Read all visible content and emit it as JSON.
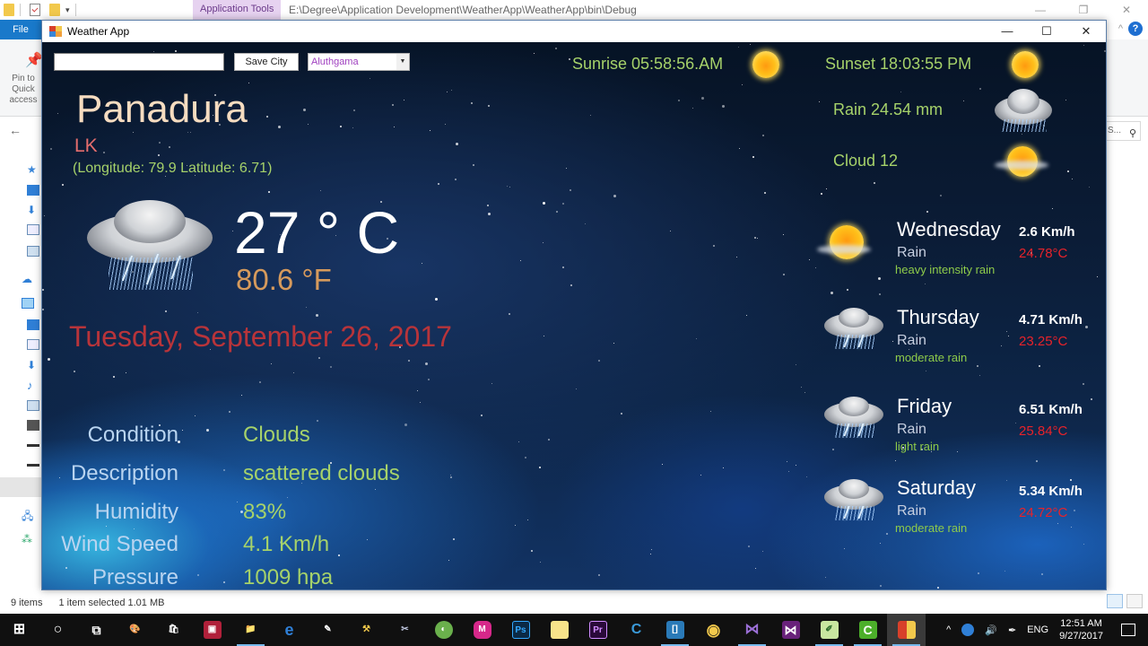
{
  "explorer": {
    "contextual_tab": "Application Tools",
    "path": "E:\\Degree\\Application Development\\WeatherApp\\WeatherApp\\bin\\Debug",
    "file_tab": "File",
    "pin_label": "Pin to Quick access",
    "search_placeholder": "S...",
    "status": {
      "items": "9 items",
      "selected": "1 item selected  1.01 MB"
    },
    "window_controls": {
      "minimize": "—",
      "restore": "❐",
      "close": "✕"
    }
  },
  "app": {
    "title": "Weather App",
    "window_controls": {
      "minimize": "—",
      "maximize": "☐",
      "close": "✕"
    },
    "controls": {
      "city_input_value": "",
      "save_button": "Save City",
      "city_select_value": "Aluthgama",
      "select_arrow": "▼"
    },
    "location": {
      "city": "Panadura",
      "country": "LK",
      "coordinates": "(Longitude: 79.9 Latitude: 6.71)"
    },
    "current": {
      "icon": "thunderstorm-icon",
      "temp_c": "27 ° C",
      "temp_f": "80.6 °F",
      "date": "Tuesday, September 26, 2017"
    },
    "sun": {
      "sunrise": "Sunrise  05:58:56.AM",
      "sunset": "Sunset 18:03:55 PM"
    },
    "extra": {
      "rain": "Rain   24.54 mm",
      "cloud": "Cloud 12"
    },
    "details": [
      {
        "label": "Condition",
        "value": "Clouds"
      },
      {
        "label": "Description",
        "value": "scattered clouds"
      },
      {
        "label": "Humidity",
        "value": "83%"
      },
      {
        "label": "Wind Speed",
        "value": "4.1 Km/h"
      },
      {
        "label": "Pressure",
        "value": "1009 hpa"
      }
    ],
    "forecast": [
      {
        "day": "Wednesday",
        "main": "Rain",
        "description": "heavy intensity rain",
        "wind": "2.6 Km/h",
        "temp": "24.78°C",
        "icon": "partly-sunny-icon"
      },
      {
        "day": "Thursday",
        "main": "Rain",
        "description": "moderate rain",
        "wind": "4.71 Km/h",
        "temp": "23.25°C",
        "icon": "thunderstorm-icon"
      },
      {
        "day": "Friday",
        "main": "Rain",
        "description": "light rain",
        "wind": "6.51 Km/h",
        "temp": "25.84°C",
        "icon": "thunderstorm-icon"
      },
      {
        "day": "Saturday",
        "main": "Rain",
        "description": "moderate rain",
        "wind": "5.34 Km/h",
        "temp": "24.72°C",
        "icon": "thunderstorm-icon"
      }
    ],
    "colors": {
      "accent_green": "#a6d26a",
      "date_red": "#b8343a",
      "forecast_temp_red": "#e8222a",
      "city_color": "#f6dcc0"
    }
  },
  "taskbar": {
    "apps": [
      {
        "name": "start",
        "glyph": "⊞"
      },
      {
        "name": "cortana",
        "glyph": "○"
      },
      {
        "name": "task-view",
        "glyph": "⧉"
      },
      {
        "name": "paint",
        "glyph": "🎨"
      },
      {
        "name": "store",
        "glyph": "🛍"
      },
      {
        "name": "remote-desktop",
        "glyph": "▣"
      },
      {
        "name": "file-explorer",
        "glyph": "📁"
      },
      {
        "name": "edge",
        "glyph": "e"
      },
      {
        "name": "eyedropper",
        "glyph": "✎"
      },
      {
        "name": "tools",
        "glyph": "⚒"
      },
      {
        "name": "snipping-tool",
        "glyph": "✂"
      },
      {
        "name": "coreldraw",
        "glyph": "◐"
      },
      {
        "name": "media-app",
        "glyph": "M"
      },
      {
        "name": "photoshop",
        "glyph": "Ps"
      },
      {
        "name": "sticky-notes",
        "glyph": "▰"
      },
      {
        "name": "premiere",
        "glyph": "Pr"
      },
      {
        "name": "ccleaner",
        "glyph": "C"
      },
      {
        "name": "brackets",
        "glyph": "[]"
      },
      {
        "name": "chrome",
        "glyph": "◉"
      },
      {
        "name": "visual-studio-2013",
        "glyph": "⋈"
      },
      {
        "name": "visual-studio",
        "glyph": "⋈"
      },
      {
        "name": "notepad-plus",
        "glyph": "✐"
      },
      {
        "name": "camtasia",
        "glyph": "C"
      },
      {
        "name": "weather-app",
        "glyph": "▦"
      }
    ],
    "tray": {
      "chevron": "^",
      "volume": "🔊",
      "language": "ENG",
      "time": "12:51 AM",
      "date": "9/27/2017"
    }
  }
}
